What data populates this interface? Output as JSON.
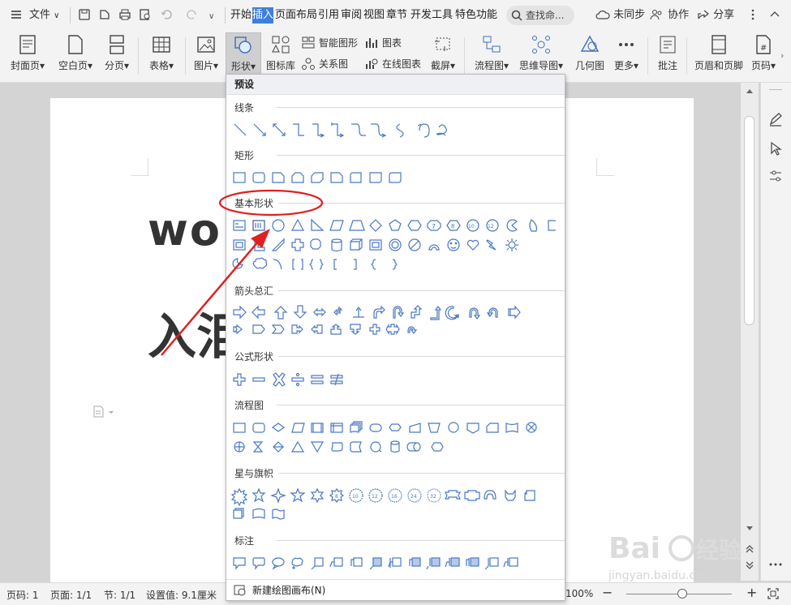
{
  "menubar": {
    "menu_icon": "hamburger-icon",
    "file_label": "文件",
    "tabs": [
      "开始",
      "插入",
      "页面布局",
      "引用",
      "审阅",
      "视图",
      "章节",
      "开发工具",
      "特色功能"
    ],
    "active_tab": "插入",
    "search_placeholder": "查找命...",
    "sync_label": "未同步",
    "collab_label": "协作",
    "share_label": "分享"
  },
  "ribbon": {
    "cover_page": "封面页",
    "blank_page": "空白页",
    "page_break": "分页",
    "table": "表格",
    "picture": "图片",
    "shape": "形状",
    "icon_library": "图标库",
    "smart_art": "智能图形",
    "chart": "图表",
    "relation_chart": "关系图",
    "online_chart": "在线图表",
    "screenshot": "截屏",
    "flowchart": "流程图",
    "mindmap": "思维导图",
    "geometry": "几何图",
    "more": "更多",
    "comment": "批注",
    "header_footer": "页眉和页脚",
    "page_number": "页码"
  },
  "document": {
    "line1": "wo",
    "line2": "入泪"
  },
  "shapes_dropdown": {
    "title": "预设",
    "sections": [
      "线条",
      "矩形",
      "基本形状",
      "箭头总汇",
      "公式形状",
      "流程图",
      "星与旗帜",
      "标注"
    ],
    "footer_label": "新建绘图画布(N)"
  },
  "statusbar": {
    "page": "页码: 1",
    "pages": "页面: 1/1",
    "section": "节: 1/1",
    "setting": "设置值: 9.1厘米",
    "zoom": "100%"
  },
  "watermark": {
    "text": "Baidu 经验",
    "url_text": "jingyan.baidu.com"
  },
  "colors": {
    "accent": "#3c7fe0",
    "shape_stroke": "#4a78c2",
    "annotation_red": "#e02020"
  }
}
